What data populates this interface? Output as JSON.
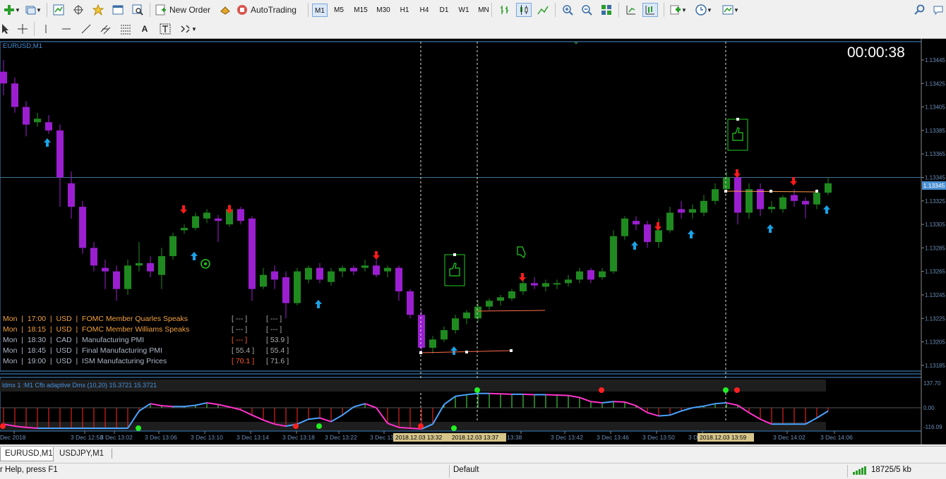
{
  "toolbar": {
    "new_order_label": "New Order",
    "autotrading_label": "AutoTrading",
    "timeframes": [
      "M1",
      "M5",
      "M15",
      "M30",
      "H1",
      "H4",
      "D1",
      "W1",
      "MN"
    ],
    "active_timeframe": "M1"
  },
  "chart": {
    "symbol_title": "EURUSD,M1",
    "countdown": "00:00:38",
    "current_price": "1.13345",
    "price_labels": [
      "1.13445",
      "1.13425",
      "1.13405",
      "1.13385",
      "1.13365",
      "1.13345",
      "1.13325",
      "1.13305",
      "1.13285",
      "1.13265",
      "1.13245",
      "1.13225",
      "1.13205",
      "1.13185"
    ],
    "time_labels": [
      "Dec 2018",
      "3 Dec 12:58",
      "3 Dec 13:02",
      "3 Dec 13:06",
      "3 Dec 13:10",
      "3 Dec 13:14",
      "3 Dec 13:18",
      "3 Dec 13:22",
      "3 Dec 13:26",
      "13:38",
      "3 Dec 13:42",
      "3 Dec 13:46",
      "3 Dec 13:50",
      "3 Dec 13:",
      "3 Dec 14:02",
      "3 Dec 14:06"
    ],
    "time_highlights": [
      "2018.12.03 13:32",
      "2018.12.03 13:37",
      "2018.12.03 13:59"
    ],
    "indicator_title": "ldmx 1 :M1 Cfb adaptive Dmx (10,20) 15.3721 15.3721",
    "indicator_labels": [
      "137.70",
      "0.00",
      "-116.09"
    ],
    "colors": {
      "bull": "#1f8a1f",
      "bear": "#9b1fd0",
      "up_arrow": "#19a3e6",
      "down_arrow": "#ff1a1a",
      "indicator_up": "#4aa3ff",
      "indicator_down": "#ff33cc"
    }
  },
  "news": [
    {
      "text": "Mon  |  17:00  |  USD  |  FOMC Member Quarles Speaks",
      "forecast": "[ --- ]",
      "previous": "[ --- ]",
      "color": "#f0a040",
      "fcolor": "#aaaaaa"
    },
    {
      "text": "Mon  |  18:15  |  USD  |  FOMC Member Williams Speaks",
      "forecast": "[ --- ]",
      "previous": "[ --- ]",
      "color": "#f0a040",
      "fcolor": "#aaaaaa"
    },
    {
      "text": "Mon  |  18:30  |  CAD  |  Manufacturing PMI",
      "forecast": "[ --- ]",
      "previous": "[ 53.9 ]",
      "color": "#aeb7c8",
      "fcolor": "#ff5a2a"
    },
    {
      "text": "Mon  |  18:45  |  USD  |  Final Manufacturing PMI",
      "forecast": "[ 55.4 ]",
      "previous": "[ 55.4 ]",
      "color": "#aeb7c8",
      "fcolor": "#aaaaaa"
    },
    {
      "text": "Mon  |  19:00  |  USD  |  ISM Manufacturing Prices",
      "forecast": "[ 70.1 ]",
      "previous": "[ 71.6 ]",
      "color": "#aeb7c8",
      "fcolor": "#ff5a2a"
    }
  ],
  "tabs": [
    "EURUSD,M1",
    "USDJPY,M1"
  ],
  "status": {
    "help": "r Help, press F1",
    "profile": "Default",
    "traffic": "18725/5 kb"
  },
  "candles": [
    [
      1.13435,
      1.13445,
      1.13415,
      1.13425
    ],
    [
      1.13425,
      1.1343,
      1.134,
      1.13405
    ],
    [
      1.13405,
      1.1341,
      1.1338,
      1.1339
    ],
    [
      1.13392,
      1.134,
      1.13388,
      1.13395
    ],
    [
      1.13392,
      1.13398,
      1.13382,
      1.13385
    ],
    [
      1.13385,
      1.1339,
      1.1332,
      1.13345
    ],
    [
      1.1334,
      1.1335,
      1.1331,
      1.1332
    ],
    [
      1.1332,
      1.13325,
      1.1328,
      1.13285
    ],
    [
      1.13285,
      1.1329,
      1.13265,
      1.1327
    ],
    [
      1.13268,
      1.13275,
      1.1325,
      1.13265
    ],
    [
      1.13265,
      1.1327,
      1.1324,
      1.1325
    ],
    [
      1.1325,
      1.13275,
      1.13245,
      1.1327
    ],
    [
      1.1327,
      1.1329,
      1.13265,
      1.13272
    ],
    [
      1.13272,
      1.13278,
      1.1326,
      1.13265
    ],
    [
      1.13262,
      1.13285,
      1.1325,
      1.13278
    ],
    [
      1.13278,
      1.13298,
      1.13275,
      1.13295
    ],
    [
      1.133,
      1.13305,
      1.13297,
      1.13302
    ],
    [
      1.13302,
      1.13315,
      1.133,
      1.13312
    ],
    [
      1.1331,
      1.13318,
      1.13306,
      1.13315
    ],
    [
      1.1331,
      1.13313,
      1.1329,
      1.13308
    ],
    [
      1.13305,
      1.13322,
      1.13303,
      1.13318
    ],
    [
      1.13318,
      1.1332,
      1.13305,
      1.13308
    ],
    [
      1.1331,
      1.13312,
      1.1324,
      1.1325
    ],
    [
      1.13252,
      1.13268,
      1.1325,
      1.13262
    ],
    [
      1.13265,
      1.1327,
      1.1325,
      1.13258
    ],
    [
      1.1326,
      1.13265,
      1.13225,
      1.13238
    ],
    [
      1.13238,
      1.13268,
      1.13236,
      1.13265
    ],
    [
      1.13258,
      1.1327,
      1.13255,
      1.13268
    ],
    [
      1.13268,
      1.13272,
      1.13255,
      1.13258
    ],
    [
      1.13256,
      1.13268,
      1.13253,
      1.13265
    ],
    [
      1.13265,
      1.1327,
      1.1326,
      1.13268
    ],
    [
      1.13268,
      1.1327,
      1.13262,
      1.13265
    ],
    [
      1.13268,
      1.13275,
      1.13265,
      1.1327
    ],
    [
      1.1327,
      1.13275,
      1.1326,
      1.13262
    ],
    [
      1.13265,
      1.1327,
      1.1326,
      1.13268
    ],
    [
      1.13268,
      1.1327,
      1.1324,
      1.13248
    ],
    [
      1.13248,
      1.1325,
      1.13225,
      1.13228
    ],
    [
      1.13228,
      1.13232,
      1.13195,
      1.132
    ],
    [
      1.132,
      1.1321,
      1.13195,
      1.13207
    ],
    [
      1.13207,
      1.13218,
      1.13205,
      1.13215
    ],
    [
      1.13215,
      1.13228,
      1.13212,
      1.13225
    ],
    [
      1.13225,
      1.13232,
      1.1322,
      1.1323
    ],
    [
      1.13225,
      1.1324,
      1.13222,
      1.13235
    ],
    [
      1.13235,
      1.13242,
      1.13232,
      1.1324
    ],
    [
      1.1324,
      1.13245,
      1.13236,
      1.13243
    ],
    [
      1.13242,
      1.1325,
      1.1324,
      1.13248
    ],
    [
      1.13248,
      1.13258,
      1.13245,
      1.13255
    ],
    [
      1.13255,
      1.1326,
      1.1325,
      1.13253
    ],
    [
      1.13252,
      1.13258,
      1.13248,
      1.13255
    ],
    [
      1.13254,
      1.13258,
      1.1325,
      1.13255
    ],
    [
      1.13255,
      1.13262,
      1.13252,
      1.13258
    ],
    [
      1.13258,
      1.13268,
      1.13255,
      1.13265
    ],
    [
      1.13266,
      1.13268,
      1.13255,
      1.13258
    ],
    [
      1.1326,
      1.13268,
      1.13258,
      1.13265
    ],
    [
      1.13265,
      1.133,
      1.13263,
      1.13295
    ],
    [
      1.13295,
      1.13312,
      1.13292,
      1.1331
    ],
    [
      1.13308,
      1.13312,
      1.133,
      1.13305
    ],
    [
      1.13305,
      1.13308,
      1.13285,
      1.1329
    ],
    [
      1.1329,
      1.1331,
      1.13285,
      1.133
    ],
    [
      1.133,
      1.1332,
      1.13298,
      1.13315
    ],
    [
      1.13318,
      1.13325,
      1.1331,
      1.13315
    ],
    [
      1.13315,
      1.13322,
      1.1331,
      1.13318
    ],
    [
      1.13315,
      1.1333,
      1.13312,
      1.13325
    ],
    [
      1.13325,
      1.1334,
      1.13322,
      1.13335
    ],
    [
      1.13335,
      1.1335,
      1.13333,
      1.13345
    ],
    [
      1.13345,
      1.13348,
      1.13305,
      1.13315
    ],
    [
      1.13315,
      1.1334,
      1.1331,
      1.13335
    ],
    [
      1.13335,
      1.1334,
      1.13312,
      1.13318
    ],
    [
      1.13318,
      1.13325,
      1.13315,
      1.1332
    ],
    [
      1.13318,
      1.1333,
      1.13315,
      1.13328
    ],
    [
      1.1333,
      1.13335,
      1.1332,
      1.13325
    ],
    [
      1.13325,
      1.13328,
      1.1331,
      1.13322
    ],
    [
      1.13322,
      1.13335,
      1.13318,
      1.13332
    ],
    [
      1.13332,
      1.13345,
      1.1333,
      1.1334
    ]
  ]
}
